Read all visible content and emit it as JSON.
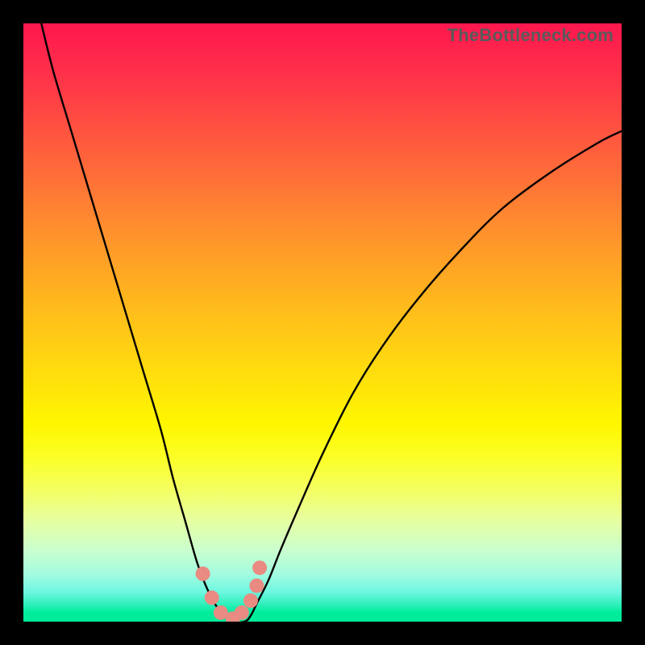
{
  "brand": "TheBottleneck.com",
  "chart_data": {
    "type": "line",
    "title": "",
    "xlabel": "",
    "ylabel": "",
    "xlim": [
      0,
      100
    ],
    "ylim": [
      0,
      100
    ],
    "x": [
      3,
      5,
      8,
      11,
      14,
      17,
      20,
      23,
      25,
      27,
      29,
      30.5,
      32,
      33.5,
      35,
      37,
      38,
      39,
      41,
      43,
      46,
      50,
      55,
      60,
      66,
      73,
      80,
      88,
      96,
      100
    ],
    "values": [
      100,
      92,
      82,
      72,
      62,
      52,
      42,
      32,
      24,
      17,
      10,
      6,
      3,
      1,
      0,
      0,
      1,
      3,
      7,
      12,
      19,
      28,
      38,
      46,
      54,
      62,
      69,
      75,
      80,
      82
    ],
    "markers": {
      "x": [
        30,
        31.5,
        33,
        35,
        36.5,
        38,
        39,
        39.5
      ],
      "y": [
        8,
        4,
        1.5,
        0.5,
        1.5,
        3.5,
        6,
        9
      ]
    }
  }
}
